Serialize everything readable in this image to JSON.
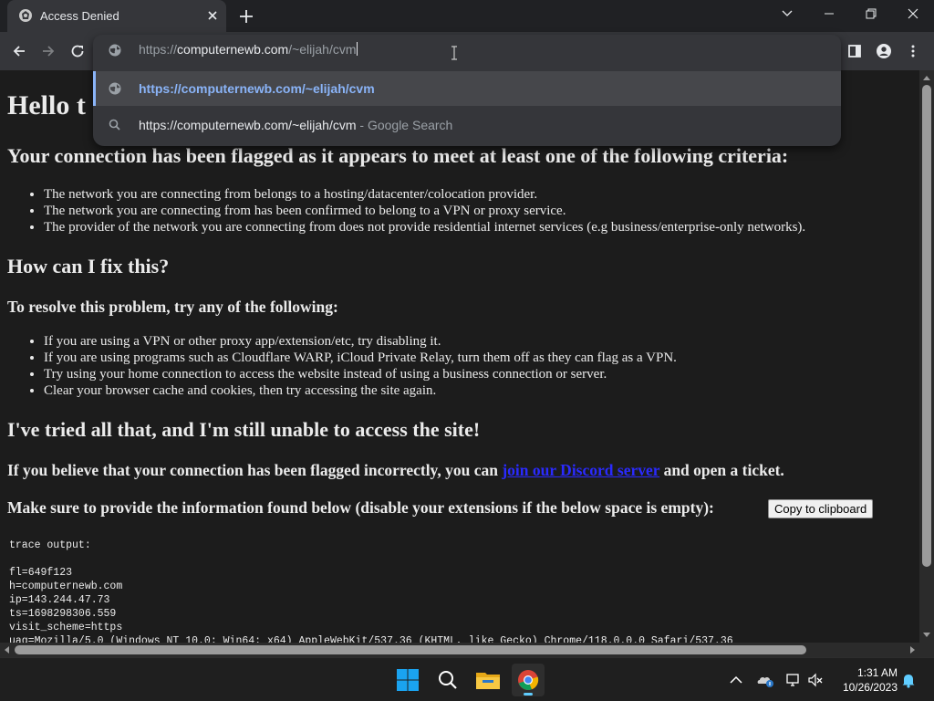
{
  "browser": {
    "tab_title": "Access Denied",
    "address_prefix": "https://",
    "address_host": "computernewb.com",
    "address_path": "/~elijah/cvm",
    "suggestions": [
      {
        "text": "https://computernewb.com/~elijah/cvm",
        "suffix": "",
        "icon": "globe-icon"
      },
      {
        "text": "https://computernewb.com/~elijah/cvm",
        "suffix": " - Google Search",
        "icon": "search-icon"
      }
    ]
  },
  "page": {
    "title": "Hello t",
    "flagged_heading": "Your connection has been flagged as it appears to meet at least one of the following criteria:",
    "criteria": [
      "The network you are connecting from belongs to a hosting/datacenter/colocation provider.",
      "The network you are connecting from has been confirmed to belong to a VPN or proxy service.",
      "The provider of the network you are connecting from does not provide residential internet services (e.g business/enterprise-only networks)."
    ],
    "fix_heading": "How can I fix this?",
    "resolve_heading": "To resolve this problem, try any of the following:",
    "fixes": [
      "If you are using a VPN or other proxy app/extension/etc, try disabling it.",
      "If you are using programs such as Cloudflare WARP, iCloud Private Relay, turn them off as they can flag as a VPN.",
      "Try using your home connection to access the website instead of using a business connection or server.",
      "Clear your browser cache and cookies, then try accessing the site again."
    ],
    "tried_heading": "I've tried all that, and I'm still unable to access the site!",
    "incorrect_before": "If you believe that your connection has been flagged incorrectly, you can ",
    "incorrect_link": "join our Discord server",
    "incorrect_after": " and open a ticket.",
    "info_text": "Make sure to provide the information found below (disable your extensions if the below space is empty):",
    "copy_button": "Copy to clipboard",
    "trace_output": "trace output:\n\nfl=649f123\nh=computernewb.com\nip=143.244.47.73\nts=1698298306.559\nvisit_scheme=https\nuag=Mozilla/5.0 (Windows NT 10.0; Win64; x64) AppleWebKit/537.36 (KHTML, like Gecko) Chrome/118.0.0.0 Safari/537.36"
  },
  "taskbar": {
    "time": "1:31 AM",
    "date": "10/26/2023"
  },
  "colors": {
    "link": "#2a2aff",
    "omnibox_selected": "#8ab4f8",
    "page_bg": "#1c1c1c"
  }
}
